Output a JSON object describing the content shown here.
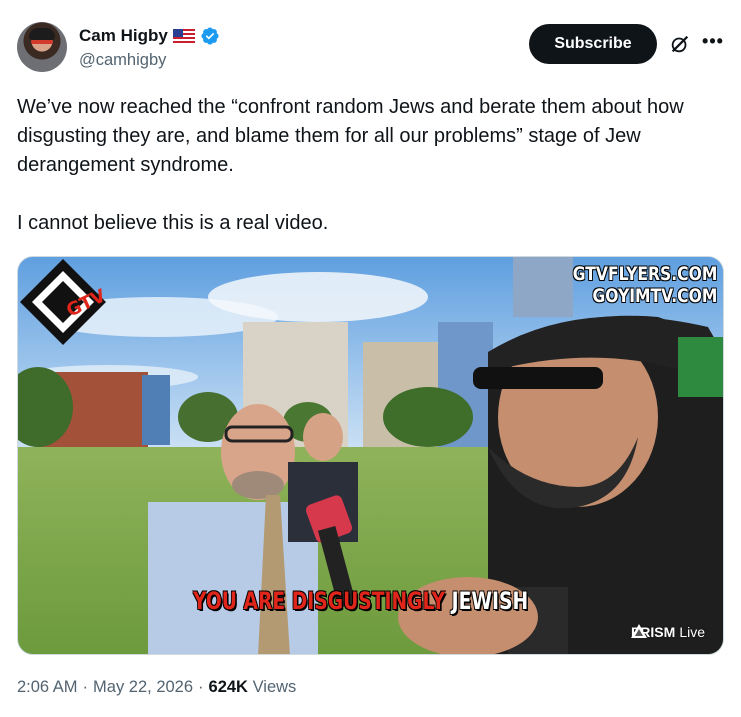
{
  "author": {
    "display_name": "Cam Higby",
    "handle": "@camhigby",
    "flag_icon": "us-flag-icon",
    "verified_icon": "verified-badge-icon",
    "verified_color": "#1d9bf0"
  },
  "header": {
    "subscribe_label": "Subscribe",
    "grok_icon": "grok-icon",
    "more_icon": "more-icon"
  },
  "tweet": {
    "paragraph_1": "We’ve now reached the “confront random Jews and berate them about how disgusting they are, and blame them for all our problems” stage of Jew derangement syndrome.",
    "paragraph_2": "I cannot believe this is a real video."
  },
  "media": {
    "watermark_line_1": "GTVFLYERS.COM",
    "watermark_line_2": "GOYIMTV.COM",
    "caption_red": "YOU ARE DISGUSTINGLY",
    "caption_white": "JEWISH",
    "logo_text": "GTV",
    "prism_label": "PRISM",
    "prism_live": "Live"
  },
  "meta": {
    "time": "2:06 AM",
    "sep1": "·",
    "date": "May 22, 2026",
    "sep2": "·",
    "views_count": "624K",
    "views_label": "Views"
  },
  "colors": {
    "text_primary": "#0f1419",
    "text_secondary": "#536471",
    "caption_red": "#e0251b"
  }
}
